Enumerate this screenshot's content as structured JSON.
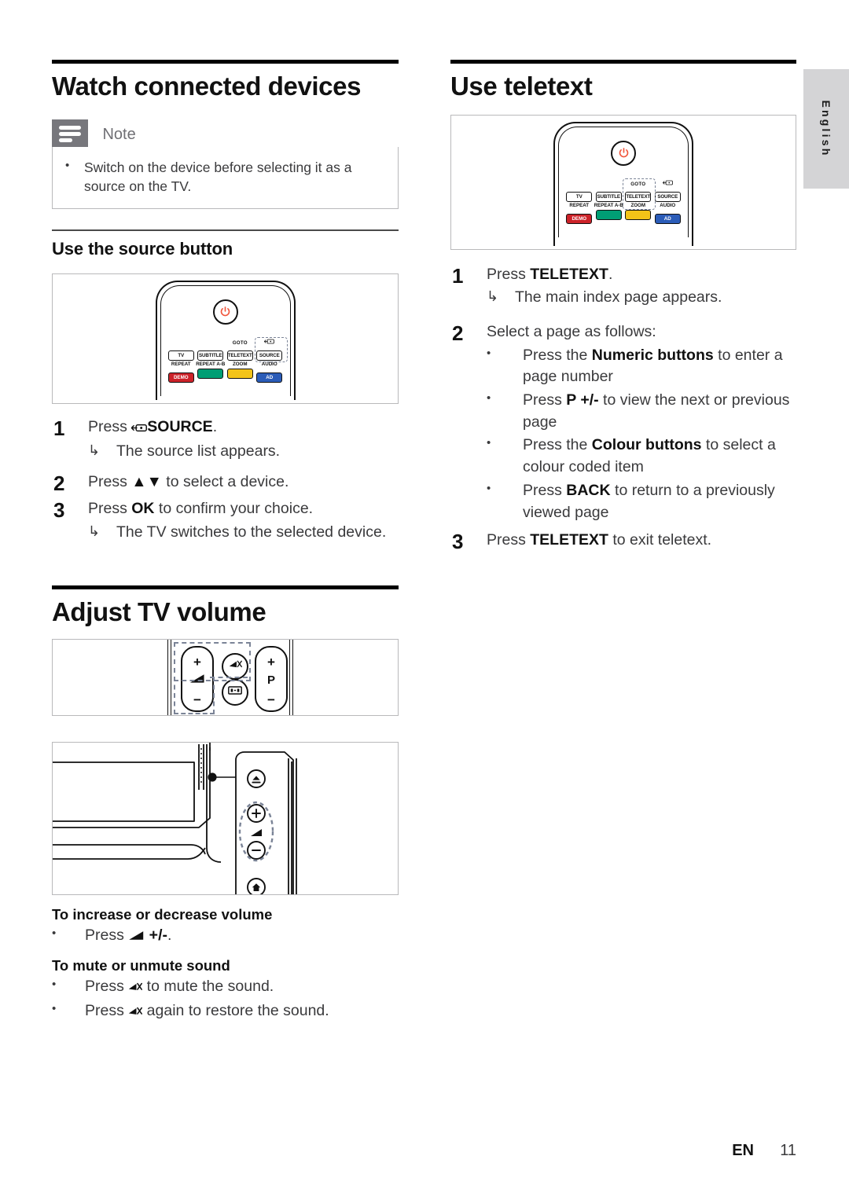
{
  "page": {
    "language_tab": "English",
    "footer": {
      "locale": "EN",
      "page_number": "11"
    }
  },
  "left_column": {
    "section_title": "Watch connected devices",
    "note": {
      "icon": "note-icon",
      "label": "Note",
      "bullet_marker": "•",
      "text": "Switch on the device before selecting it as a source on the TV."
    },
    "subsection_title": "Use the source button",
    "remote_figure": {
      "name": "remote-control-source-illustration",
      "power_icon": "power-icon",
      "top_labels": [
        "",
        "",
        "GOTO",
        "source-input-icon"
      ],
      "keys": [
        "TV",
        "SUBTITLE",
        "TELETEXT",
        "SOURCE"
      ],
      "bottom_labels": [
        "REPEAT",
        "REPEAT A-B",
        "ZOOM",
        "AUDIO"
      ],
      "colour_keys": [
        {
          "label": "DEMO",
          "color": "#cc2229"
        },
        {
          "label": "",
          "color": "#009e74"
        },
        {
          "label": "",
          "color": "#f3c318"
        },
        {
          "label": "AD",
          "color": "#2b5cb8"
        }
      ],
      "highlighted_key": "SOURCE"
    },
    "steps": [
      {
        "num": "1",
        "text_before": "Press ",
        "icon": "source-input-icon",
        "bold": "SOURCE",
        "text_after": ".",
        "result_marker": "↳",
        "result": "The source list appears."
      },
      {
        "num": "2",
        "text_before": "Press ",
        "bold": "▲▼",
        "text_after": " to select a device."
      },
      {
        "num": "3",
        "text_before": "Press ",
        "bold": "OK",
        "text_after": " to confirm your choice.",
        "result_marker": "↳",
        "result": "The TV switches to the selected device."
      }
    ],
    "volume_section_title": "Adjust TV volume",
    "volume_figure": {
      "name": "remote-volume-buttons-illustration",
      "volume_pill": {
        "plus": "+",
        "icon": "volume-icon",
        "minus": "−"
      },
      "mute_button": "mute-icon",
      "format_button": "picture-format-icon",
      "program_pill": {
        "plus": "+",
        "letter": "P",
        "minus": "−"
      }
    },
    "tv_figure": {
      "name": "tv-side-panel-illustration",
      "buttons": [
        "eject-source-icon",
        "plus-icon",
        "volume-icon",
        "minus-icon",
        "home-icon"
      ]
    },
    "howto": [
      {
        "title": "To increase or decrease volume",
        "items": [
          {
            "marker": "•",
            "text_before": "Press ",
            "icon": "volume-icon",
            "bold": " +/-",
            "text_after": "."
          }
        ]
      },
      {
        "title": "To mute or unmute sound",
        "items": [
          {
            "marker": "•",
            "text_before": "Press ",
            "icon": "mute-icon",
            "text_after": " to mute the sound."
          },
          {
            "marker": "•",
            "text_before": "Press ",
            "icon": "mute-icon",
            "text_after": " again to restore the sound."
          }
        ]
      }
    ]
  },
  "right_column": {
    "section_title": "Use teletext",
    "remote_figure": {
      "name": "remote-control-teletext-illustration",
      "power_icon": "power-icon",
      "top_labels": [
        "",
        "",
        "GOTO",
        "source-input-icon"
      ],
      "keys": [
        "TV",
        "SUBTITLE",
        "TELETEXT",
        "SOURCE"
      ],
      "bottom_labels": [
        "REPEAT",
        "REPEAT A-B",
        "ZOOM",
        "AUDIO"
      ],
      "colour_keys": [
        {
          "label": "DEMO",
          "color": "#cc2229"
        },
        {
          "label": "",
          "color": "#009e74"
        },
        {
          "label": "",
          "color": "#f3c318"
        },
        {
          "label": "AD",
          "color": "#2b5cb8"
        }
      ],
      "highlighted_key": "TELETEXT"
    },
    "steps": [
      {
        "num": "1",
        "text_before": "Press ",
        "bold": "TELETEXT",
        "text_after": ".",
        "result_marker": "↳",
        "result": "The main index page appears."
      },
      {
        "num": "2",
        "text": "Select a page as follows:",
        "bullets": [
          {
            "marker": "•",
            "text_before": "Press the ",
            "bold": "Numeric buttons",
            "text_after": " to enter a page number"
          },
          {
            "marker": "•",
            "text_before": "Press ",
            "bold": "P +/-",
            "text_after": " to view the next or previous page"
          },
          {
            "marker": "•",
            "text_before": "Press the ",
            "bold": "Colour buttons",
            "text_after": " to select a colour coded item"
          },
          {
            "marker": "•",
            "text_before": "Press ",
            "bold": "BACK",
            "text_after": " to return to a previously viewed page"
          }
        ]
      },
      {
        "num": "3",
        "text_before": "Press ",
        "bold": "TELETEXT",
        "text_after": " to exit teletext."
      }
    ]
  }
}
